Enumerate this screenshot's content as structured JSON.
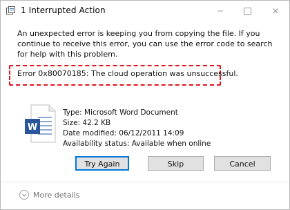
{
  "window": {
    "title": "1 Interrupted Action",
    "controls": {
      "minimize": "─",
      "maximize": "",
      "close": "✕"
    }
  },
  "dialog": {
    "message": "An unexpected error is keeping you from copying the file. If you continue to receive this error, you can use the error code to search for help with this problem.",
    "error_text": "Error 0x80070185: The cloud operation was unsuccessful.",
    "file_details": [
      "Type: Microsoft Word Document",
      "Size: 42.2 KB",
      "Date modified: 06/12/2011 14:09",
      "Availability status: Available when online"
    ],
    "buttons": {
      "try_again": "Try Again",
      "skip": "Skip",
      "cancel": "Cancel"
    },
    "more_details": "More details"
  },
  "colors": {
    "error_outline": "#e4111d",
    "focus_ring": "#0078d7",
    "word_blue": "#2b579a"
  },
  "icons": [
    "copy-action-icon",
    "word-document-icon",
    "expand-chevron-icon"
  ]
}
